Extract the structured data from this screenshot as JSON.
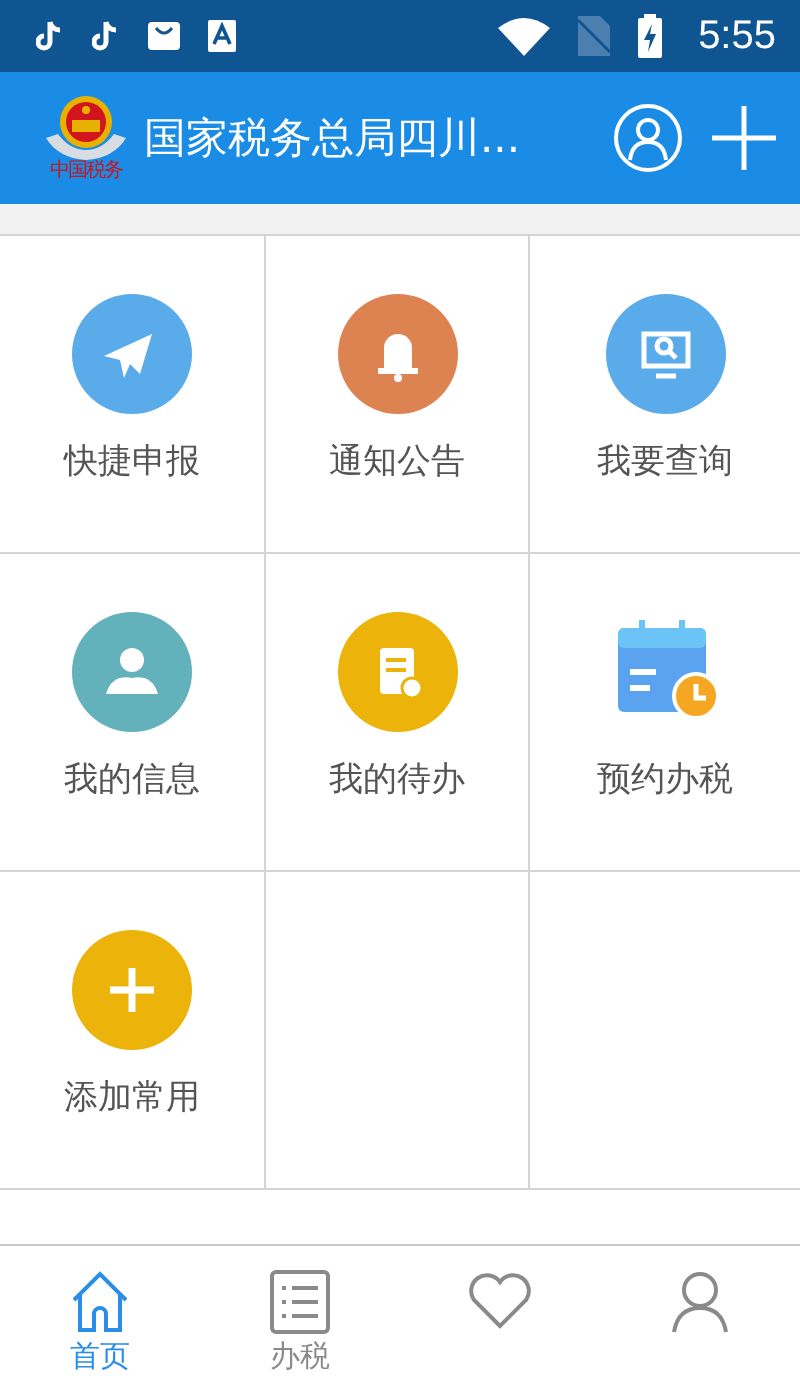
{
  "status_bar": {
    "time": "5:55"
  },
  "app_bar": {
    "logo_caption": "中国税务",
    "title": "国家税务总局四川..."
  },
  "grid": [
    {
      "label": "快捷申报",
      "kind": "plane",
      "color": "#5aabea"
    },
    {
      "label": "通知公告",
      "kind": "bell",
      "color": "#dd8352"
    },
    {
      "label": "我要查询",
      "kind": "monitor",
      "color": "#5aabea"
    },
    {
      "label": "我的信息",
      "kind": "person",
      "color": "#62b1bb"
    },
    {
      "label": "我的待办",
      "kind": "doc",
      "color": "#ecb40a"
    },
    {
      "label": "预约办税",
      "kind": "calendar",
      "color": "#5aa3f0"
    },
    {
      "label": "添加常用",
      "kind": "plus",
      "color": "#ecb40a"
    }
  ],
  "tabs": [
    {
      "label": "首页",
      "kind": "home",
      "selected": true
    },
    {
      "label": "办税",
      "kind": "list",
      "selected": false
    },
    {
      "kind": "heart",
      "selected": false
    },
    {
      "kind": "person",
      "selected": false
    }
  ]
}
